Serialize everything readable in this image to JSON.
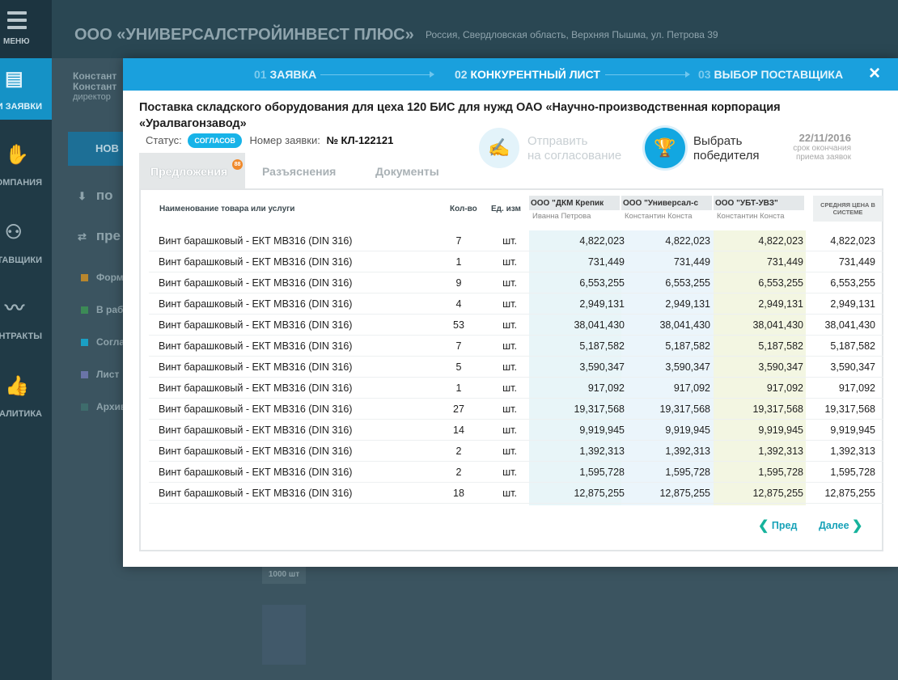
{
  "sidebar": {
    "menu_label": "МЕНЮ",
    "items": [
      {
        "label": "ОИ ЗАЯВКИ",
        "icon": "requests-icon"
      },
      {
        "label": "ОМПАНИЯ",
        "icon": "handshake-icon"
      },
      {
        "label": "СТАВЩИКИ",
        "icon": "users-icon"
      },
      {
        "label": "ОНТРАКТЫ",
        "icon": "pulse-icon"
      },
      {
        "label": "НАЛИТИКА",
        "icon": "thumbs-up-icon"
      }
    ]
  },
  "header": {
    "company": "ООО «УНИВЕРСАЛСТРОЙИНВЕСТ ПЛЮС»",
    "address": "Россия, Свердловская область, Верхняя Пышма, ул. Петрова 39"
  },
  "background": {
    "user_line1": "Констант",
    "user_line2": "Констант",
    "user_role": "директор",
    "new_button": "НОВ",
    "row1": "по",
    "row2": "пре",
    "statuses": [
      {
        "label": "Форм",
        "color": "#b8862d"
      },
      {
        "label": "В рабо",
        "color": "#3c8a56"
      },
      {
        "label": "Согла",
        "color": "#1a9fc4"
      },
      {
        "label": "Лист",
        "color": "#6a74a8"
      },
      {
        "label": "Архив",
        "color": "#3e6c6c"
      }
    ],
    "chip": "1000 шт"
  },
  "modal": {
    "steps": [
      {
        "num": "01",
        "label": "ЗАЯВКА"
      },
      {
        "num": "02",
        "label": "КОНКУРЕНТНЫЙ ЛИСТ"
      },
      {
        "num": "03",
        "label": "ВЫБОР ПОСТАВЩИКА"
      }
    ],
    "close_icon": "×",
    "title": "Поставка складского оборудования для цеха 120 БИС для нужд ОАО «Научно-производственная корпорация «Уралвагонзавод»",
    "status_label": "Статус:",
    "status_value": "согласов",
    "order_label": "Номер заявки:",
    "order_number": "№ КЛ-122121",
    "send_action": {
      "line1": "Отправить",
      "line2": "на согласование"
    },
    "winner_action": {
      "line1": "Выбрать",
      "line2": "победителя"
    },
    "deadline": {
      "date": "22/11/2016",
      "label1": "срок окончания",
      "label2": "приема заявок"
    },
    "tabs": [
      {
        "label": "Предложения",
        "badge": "88"
      },
      {
        "label": "Разъяснения"
      },
      {
        "label": "Документы"
      }
    ],
    "table": {
      "headers": {
        "name": "Наименование товара или услуги",
        "qty": "Кол-во",
        "unit": "Ед. изм",
        "avg": "Средняя цена в системе"
      },
      "suppliers": [
        {
          "name": "ООО \"ДКМ Крепик",
          "person": "Иванна Петрова",
          "color": "#e7f4f7"
        },
        {
          "name": "ООО \"Универсал-с",
          "person": "Константин Конста",
          "color": "#e9f4fb"
        },
        {
          "name": "ООО \"УБТ-УВЗ\"",
          "person": "Константин Конста",
          "color": "#f3f6e3"
        }
      ],
      "rows": [
        {
          "name": "Винт барашковый - ЕКТ МВ316 (DIN 316)",
          "qty": "7",
          "unit": "шт.",
          "p1": "4,822,023",
          "p2": "4,822,023",
          "p3": "4,822,023",
          "avg": "4,822,023"
        },
        {
          "name": "Винт барашковый - ЕКТ МВ316 (DIN 316)",
          "qty": "1",
          "unit": "шт.",
          "p1": "731,449",
          "p2": "731,449",
          "p3": "731,449",
          "avg": "731,449"
        },
        {
          "name": "Винт барашковый - ЕКТ МВ316 (DIN 316)",
          "qty": "9",
          "unit": "шт.",
          "p1": "6,553,255",
          "p2": "6,553,255",
          "p3": "6,553,255",
          "avg": "6,553,255"
        },
        {
          "name": "Винт барашковый - ЕКТ МВ316 (DIN 316)",
          "qty": "4",
          "unit": "шт.",
          "p1": "2,949,131",
          "p2": "2,949,131",
          "p3": "2,949,131",
          "avg": "2,949,131"
        },
        {
          "name": "Винт барашковый - ЕКТ МВ316 (DIN 316)",
          "qty": "53",
          "unit": "шт.",
          "p1": "38,041,430",
          "p2": "38,041,430",
          "p3": "38,041,430",
          "avg": "38,041,430"
        },
        {
          "name": "Винт барашковый - ЕКТ МВ316 (DIN 316)",
          "qty": "7",
          "unit": "шт.",
          "p1": "5,187,582",
          "p2": "5,187,582",
          "p3": "5,187,582",
          "avg": "5,187,582"
        },
        {
          "name": "Винт барашковый - ЕКТ МВ316 (DIN 316)",
          "qty": "5",
          "unit": "шт.",
          "p1": "3,590,347",
          "p2": "3,590,347",
          "p3": "3,590,347",
          "avg": "3,590,347"
        },
        {
          "name": "Винт барашковый - ЕКТ МВ316 (DIN 316)",
          "qty": "1",
          "unit": "шт.",
          "p1": "917,092",
          "p2": "917,092",
          "p3": "917,092",
          "avg": "917,092"
        },
        {
          "name": "Винт барашковый - ЕКТ МВ316 (DIN 316)",
          "qty": "27",
          "unit": "шт.",
          "p1": "19,317,568",
          "p2": "19,317,568",
          "p3": "19,317,568",
          "avg": "19,317,568"
        },
        {
          "name": "Винт барашковый - ЕКТ МВ316 (DIN 316)",
          "qty": "14",
          "unit": "шт.",
          "p1": "9,919,945",
          "p2": "9,919,945",
          "p3": "9,919,945",
          "avg": "9,919,945"
        },
        {
          "name": "Винт барашковый - ЕКТ МВ316 (DIN 316)",
          "qty": "2",
          "unit": "шт.",
          "p1": "1,392,313",
          "p2": "1,392,313",
          "p3": "1,392,313",
          "avg": "1,392,313"
        },
        {
          "name": "Винт барашковый - ЕКТ МВ316 (DIN 316)",
          "qty": "2",
          "unit": "шт.",
          "p1": "1,595,728",
          "p2": "1,595,728",
          "p3": "1,595,728",
          "avg": "1,595,728"
        },
        {
          "name": "Винт барашковый - ЕКТ МВ316 (DIN 316)",
          "qty": "18",
          "unit": "шт.",
          "p1": "12,875,255",
          "p2": "12,875,255",
          "p3": "12,875,255",
          "avg": "12,875,255"
        }
      ]
    },
    "pager": {
      "prev": "Пред",
      "next": "Далее"
    }
  }
}
